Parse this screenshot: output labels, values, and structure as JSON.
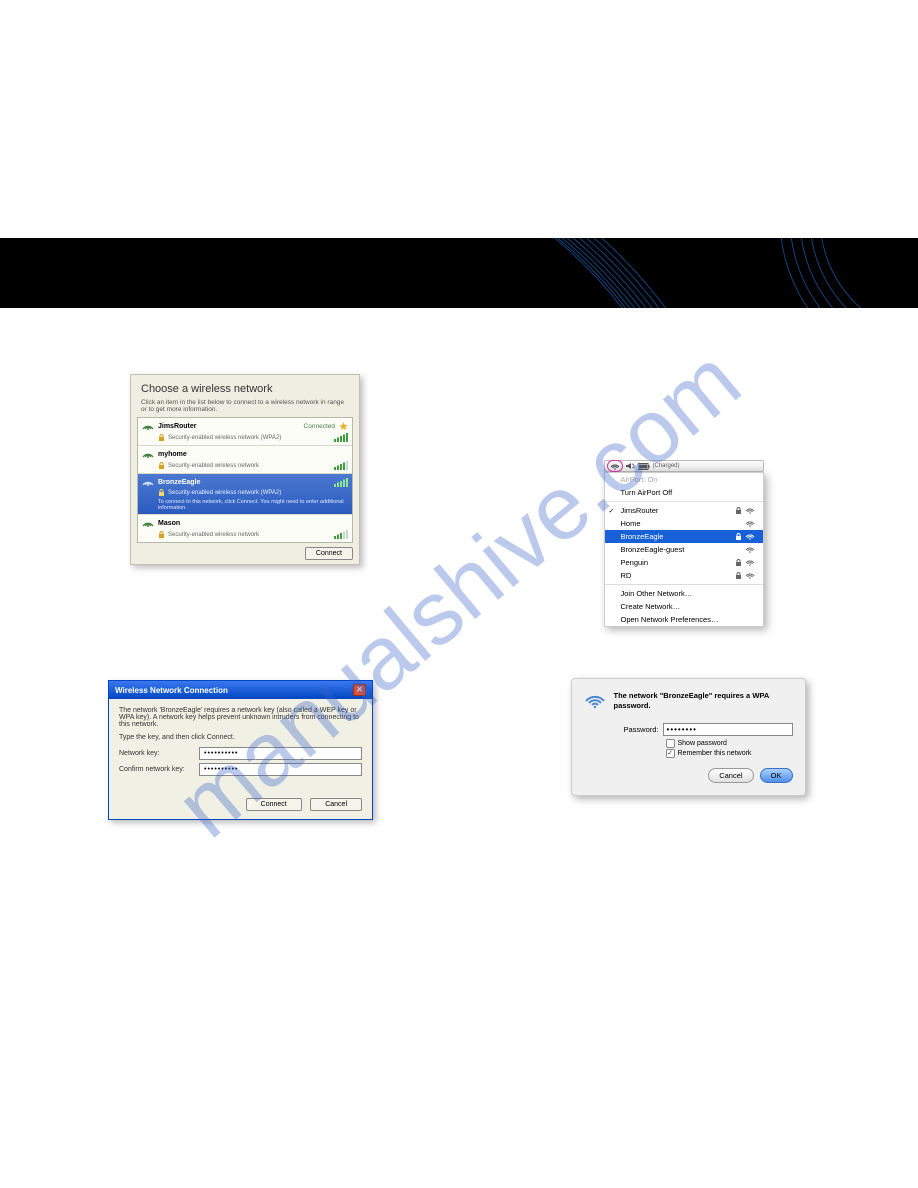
{
  "watermark": "manualshive.com",
  "win_panel": {
    "title": "Choose a wireless network",
    "subtitle": "Click an item in the list below to connect to a wireless network in range or to get more information.",
    "items": [
      {
        "name": "JimsRouter",
        "status": "Connected",
        "security": "Security-enabled wireless network (WPA2)",
        "starred": true,
        "selected": false
      },
      {
        "name": "myhome",
        "status": "",
        "security": "Security-enabled wireless network",
        "starred": false,
        "selected": false
      },
      {
        "name": "BronzeEagle",
        "status": "",
        "security": "Security-enabled wireless network (WPA2)",
        "tip": "To connect to this network, click Connect. You might need to enter additional information.",
        "starred": false,
        "selected": true
      },
      {
        "name": "Mason",
        "status": "",
        "security": "Security-enabled wireless network",
        "starred": false,
        "selected": false
      }
    ],
    "connect_btn": "Connect"
  },
  "xp_dialog": {
    "title": "Wireless Network Connection",
    "body1": "The network 'BronzeEagle' requires a network key (also called a WEP key or WPA key). A network key helps prevent unknown intruders from connecting to this network.",
    "body2": "Type the key, and then click Connect.",
    "key_label": "Network key:",
    "confirm_label": "Confirm network key:",
    "key_value": "••••••••••",
    "confirm_value": "••••••••••",
    "connect_btn": "Connect",
    "cancel_btn": "Cancel"
  },
  "mac_menubar": {
    "charged": "(Charged)"
  },
  "mac_menu": {
    "status": "AirPort: On",
    "turn_off": "Turn AirPort Off",
    "networks": [
      {
        "name": "JimsRouter",
        "checked": true,
        "locked": true,
        "selected": false
      },
      {
        "name": "Home",
        "checked": false,
        "locked": false,
        "selected": false
      },
      {
        "name": "BronzeEagle",
        "checked": false,
        "locked": true,
        "selected": true
      },
      {
        "name": "BronzeEagle-guest",
        "checked": false,
        "locked": false,
        "selected": false
      },
      {
        "name": "Penguin",
        "checked": false,
        "locked": true,
        "selected": false
      },
      {
        "name": "RD",
        "checked": false,
        "locked": true,
        "selected": false
      }
    ],
    "join_other": "Join Other Network…",
    "create": "Create Network…",
    "prefs": "Open Network Preferences…"
  },
  "mac_dialog": {
    "title": "The network \"BronzeEagle\" requires a WPA password.",
    "pw_label": "Password:",
    "pw_value": "••••••••",
    "show_pw": "Show password",
    "remember": "Remember this network",
    "remember_checked": true,
    "cancel": "Cancel",
    "ok": "OK"
  }
}
